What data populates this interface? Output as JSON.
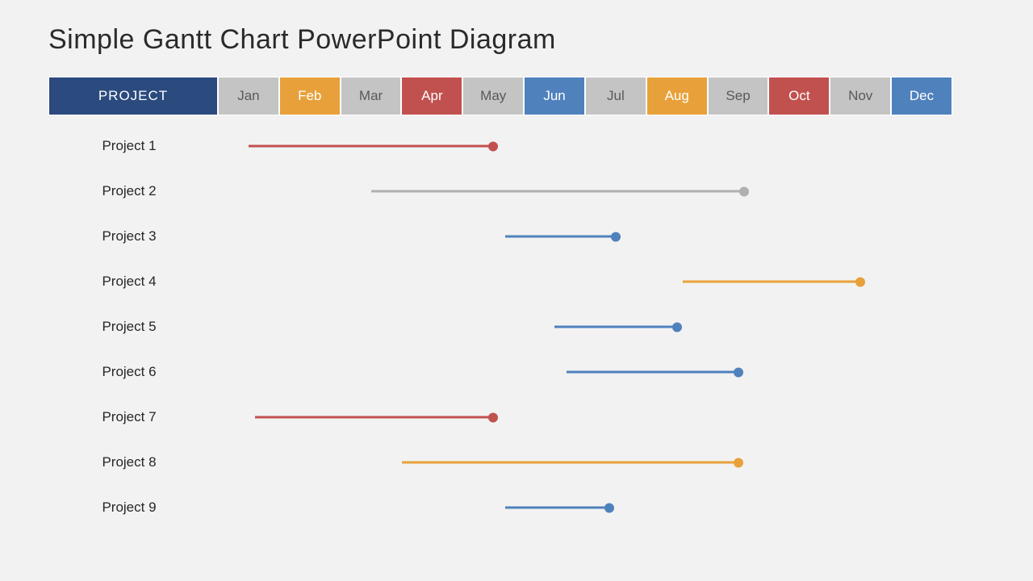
{
  "title": "Simple Gantt Chart PowerPoint Diagram",
  "project_header": "PROJECT",
  "colors": {
    "navy": "#2b4a7e",
    "gray": "#c4c4c4",
    "orange": "#e8a13a",
    "red": "#c1514f",
    "blue": "#4f81bd",
    "silver": "#b0b0b0",
    "text_gray": "#595959"
  },
  "months": [
    {
      "label": "Jan",
      "bg": "gray",
      "dark": true
    },
    {
      "label": "Feb",
      "bg": "orange",
      "dark": false
    },
    {
      "label": "Mar",
      "bg": "gray",
      "dark": true
    },
    {
      "label": "Apr",
      "bg": "red",
      "dark": false
    },
    {
      "label": "May",
      "bg": "gray",
      "dark": true
    },
    {
      "label": "Jun",
      "bg": "blue",
      "dark": false
    },
    {
      "label": "Jul",
      "bg": "gray",
      "dark": true
    },
    {
      "label": "Aug",
      "bg": "orange",
      "dark": false
    },
    {
      "label": "Sep",
      "bg": "gray",
      "dark": true
    },
    {
      "label": "Oct",
      "bg": "red",
      "dark": false
    },
    {
      "label": "Nov",
      "bg": "gray",
      "dark": true
    },
    {
      "label": "Dec",
      "bg": "blue",
      "dark": false
    }
  ],
  "chart_data": {
    "type": "bar",
    "title": "Simple Gantt Chart PowerPoint Diagram",
    "xlabel": "",
    "ylabel": "",
    "x_categories": [
      "Jan",
      "Feb",
      "Mar",
      "Apr",
      "May",
      "Jun",
      "Jul",
      "Aug",
      "Sep",
      "Oct",
      "Nov",
      "Dec"
    ],
    "series": [
      {
        "name": "Project 1",
        "start": 0.5,
        "end": 4.5,
        "color": "red"
      },
      {
        "name": "Project 2",
        "start": 2.5,
        "end": 8.6,
        "color": "silver"
      },
      {
        "name": "Project 3",
        "start": 4.7,
        "end": 6.5,
        "color": "blue"
      },
      {
        "name": "Project 4",
        "start": 7.6,
        "end": 10.5,
        "color": "orange"
      },
      {
        "name": "Project 5",
        "start": 5.5,
        "end": 7.5,
        "color": "blue"
      },
      {
        "name": "Project 6",
        "start": 5.7,
        "end": 8.5,
        "color": "blue"
      },
      {
        "name": "Project 7",
        "start": 0.6,
        "end": 4.5,
        "color": "red"
      },
      {
        "name": "Project 8",
        "start": 3.0,
        "end": 8.5,
        "color": "orange"
      },
      {
        "name": "Project 9",
        "start": 4.7,
        "end": 6.4,
        "color": "blue"
      }
    ]
  }
}
